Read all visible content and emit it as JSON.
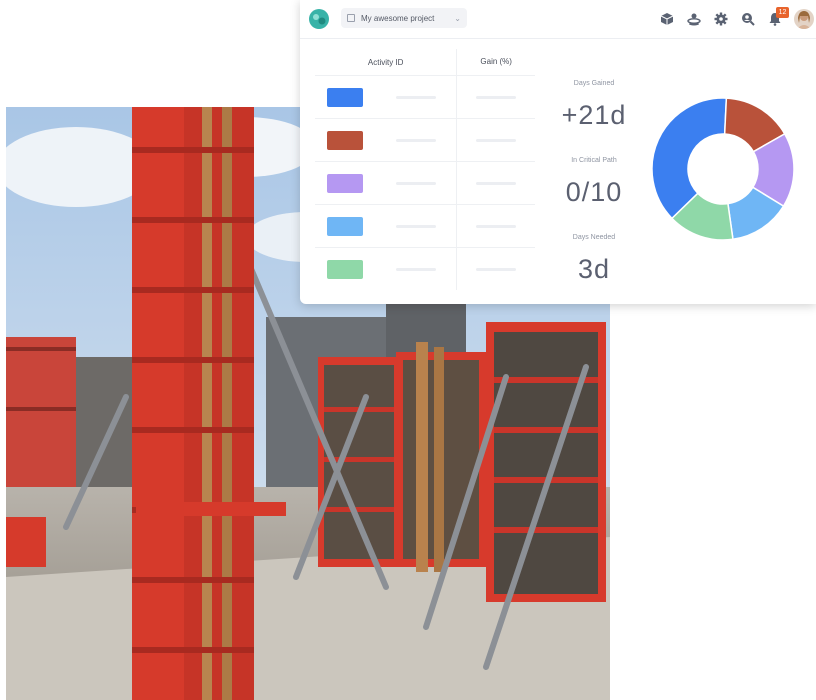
{
  "header": {
    "project_label": "My awesome project",
    "notification_count": "12"
  },
  "table": {
    "columns": [
      "Activity ID",
      "Gain (%)"
    ],
    "rows": [
      {
        "color": "#3b7ff0"
      },
      {
        "color": "#b9523a"
      },
      {
        "color": "#b598f2"
      },
      {
        "color": "#6fb6f5"
      },
      {
        "color": "#8fd8a8"
      }
    ]
  },
  "stats": [
    {
      "label": "Days Gained",
      "value": "+21d"
    },
    {
      "label": "In Critical Path",
      "value": "0/10"
    },
    {
      "label": "Days Needed",
      "value": "3d"
    }
  ],
  "chart_data": {
    "type": "pie",
    "donut": true,
    "slices": [
      {
        "color": "#3b7ff0",
        "value": 38
      },
      {
        "color": "#b9523a",
        "value": 16
      },
      {
        "color": "#b598f2",
        "value": 17
      },
      {
        "color": "#6fb6f5",
        "value": 14
      },
      {
        "color": "#8fd8a8",
        "value": 15
      }
    ]
  },
  "icons": [
    "cube-icon",
    "layers-icon",
    "gear-icon",
    "search-user-icon",
    "bell-icon"
  ]
}
